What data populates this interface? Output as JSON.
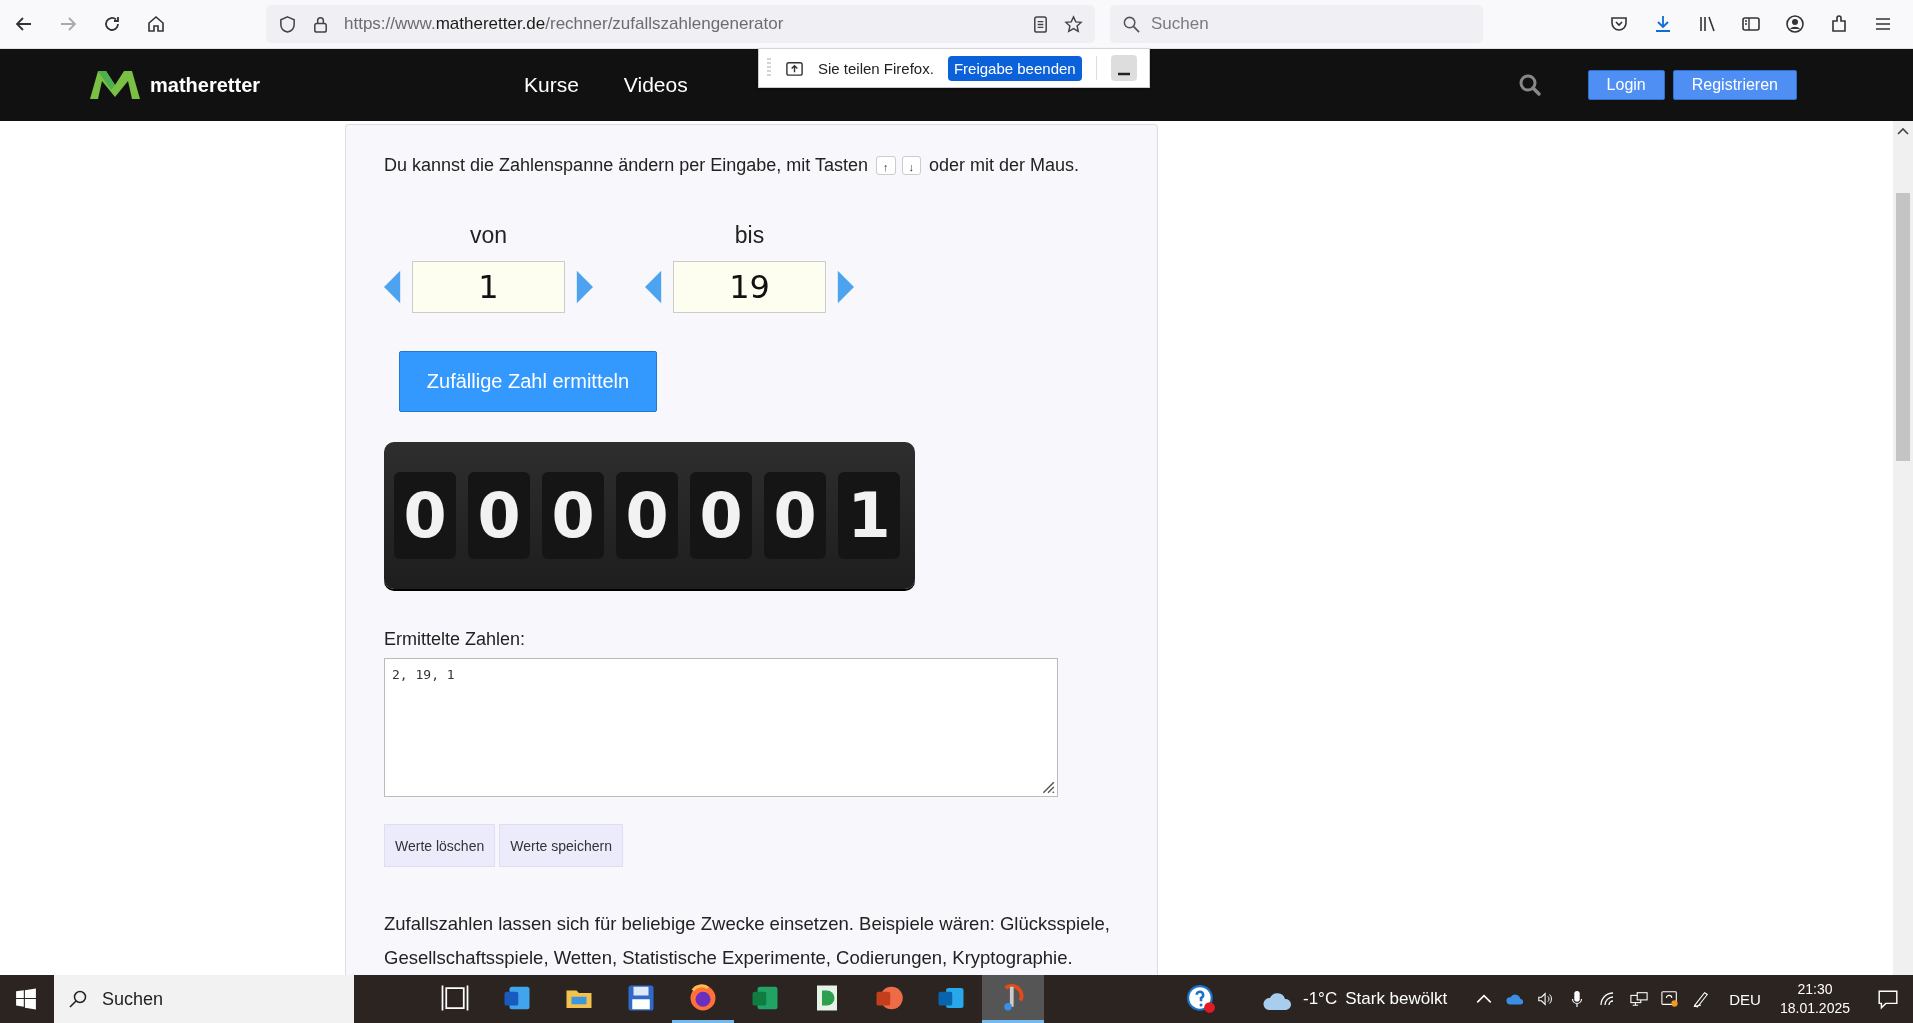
{
  "browser": {
    "url": {
      "scheme": "https://www.",
      "domain": "matheretter.de",
      "path": "/rechner/zufallszahlengenerator"
    },
    "search": {
      "placeholder": "Suchen"
    }
  },
  "sharing_bar": {
    "text": "Sie teilen Firefox.",
    "button": "Freigabe beenden"
  },
  "site_header": {
    "logo_text": "matheretter",
    "nav": [
      "Kurse",
      "Videos"
    ],
    "buttons": [
      "Login",
      "Registrieren"
    ]
  },
  "calculator": {
    "intro_before": "Du kannst die Zahlenspanne ändern per Eingabe, mit Tasten",
    "keys": [
      "↑",
      "↓"
    ],
    "intro_after": "oder mit der Maus.",
    "ranges": [
      {
        "label": "von",
        "value": "1"
      },
      {
        "label": "bis",
        "value": "19"
      }
    ],
    "generate_button": "Zufällige Zahl ermitteln",
    "counter_digits": [
      "0",
      "0",
      "0",
      "0",
      "0",
      "0",
      "1"
    ],
    "results_label": "Ermittelte Zahlen:",
    "results_value": "2, 19, 1",
    "action_buttons": [
      "Werte löschen",
      "Werte speichern"
    ],
    "description": "Zufallszahlen lassen sich für beliebige Zwecke einsetzen. Beispiele wären: Glücksspiele, Gesellschaftsspiele, Wetten, Statistische Experimente, Codierungen, Kryptographie."
  },
  "taskbar": {
    "search": {
      "placeholder": "Suchen"
    },
    "apps": [
      {
        "kind": "taskview",
        "running": false,
        "selected": false
      },
      {
        "kind": "word",
        "running": false,
        "selected": false
      },
      {
        "kind": "folder",
        "running": false,
        "selected": false
      },
      {
        "kind": "disk",
        "running": false,
        "selected": false
      },
      {
        "kind": "firefox",
        "running": true,
        "selected": false
      },
      {
        "kind": "excel",
        "running": false,
        "selected": false
      },
      {
        "kind": "green",
        "running": false,
        "selected": false
      },
      {
        "kind": "powerpoint",
        "running": false,
        "selected": false
      },
      {
        "kind": "outlook",
        "running": false,
        "selected": false
      },
      {
        "kind": "tool",
        "running": true,
        "selected": true
      }
    ],
    "weather": {
      "temperature": "-1°C",
      "condition": "Stark bewölkt"
    },
    "language": "DEU",
    "time": "21:30",
    "date": "18.01.2025"
  }
}
